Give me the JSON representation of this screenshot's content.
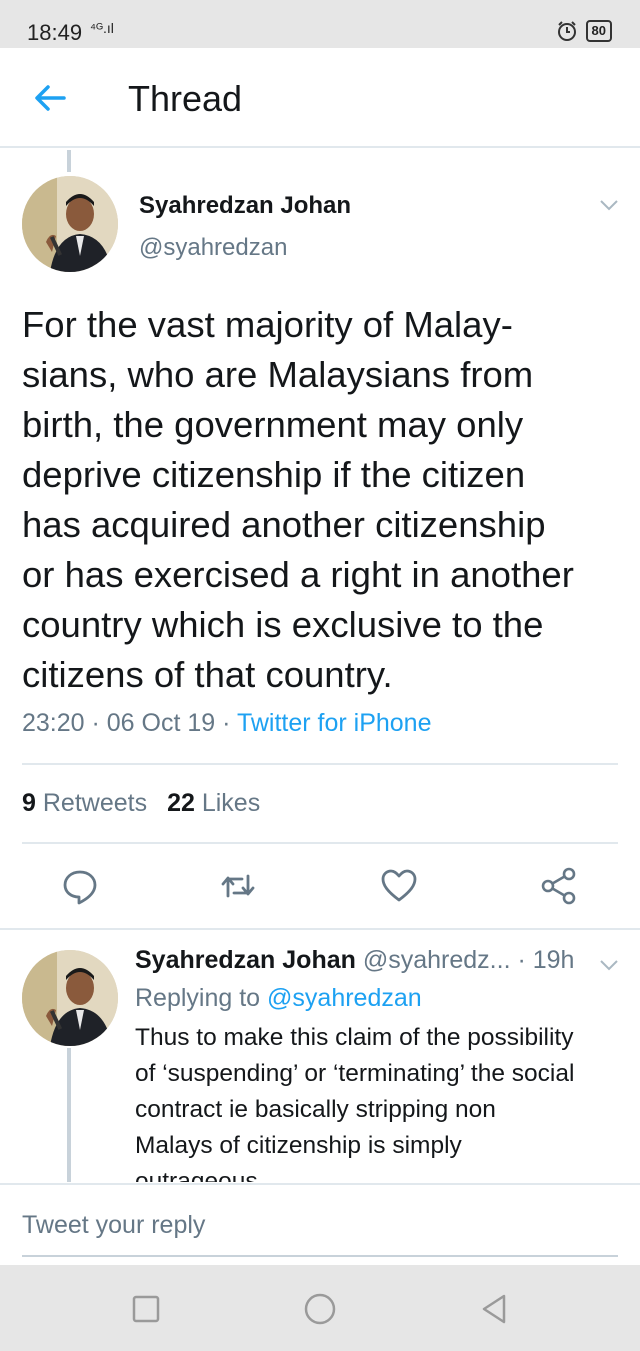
{
  "status_bar": {
    "time": "18:49",
    "signal": "⁴ᴳ.ıl",
    "battery": "80"
  },
  "header": {
    "title": "Thread"
  },
  "tweet": {
    "name": "Syahredzan Johan",
    "handle": "@syahredzan",
    "text_lines": [
      "For the vast majority of Malay-",
      "sians, who are Malaysians from",
      "birth, the government may only",
      "deprive citizenship if the citizen",
      "has acquired another citizenship",
      "or has exercised a right in another",
      "country which is exclusive to the",
      "citizens of that country."
    ],
    "time": "23:20",
    "date": "06 Oct 19",
    "source": "Twitter for iPhone",
    "retweets_count": "9",
    "retweets_label": "Retweets",
    "likes_count": "22",
    "likes_label": "Likes"
  },
  "actions": [
    "reply-icon",
    "retweet-icon",
    "like-icon",
    "share-icon"
  ],
  "reply": {
    "name": "Syahredzan Johan",
    "handle": "@syahredz...",
    "time": "19h",
    "replying_prefix": "Replying to",
    "replying_handle": "@syahredzan",
    "text_lines": [
      "Thus to make this claim of the possibility",
      "of ‘suspending’ or ‘terminating’ the social",
      "contract ie basically stripping non",
      "Malays of citizenship is simply",
      "outrageous"
    ]
  },
  "compose": {
    "placeholder": "Tweet your reply"
  },
  "nav_buttons": [
    "recents-button",
    "home-button",
    "back-nav-button"
  ],
  "colors": {
    "accent": "#1da1f2",
    "muted": "#657786",
    "text": "#14171a"
  }
}
